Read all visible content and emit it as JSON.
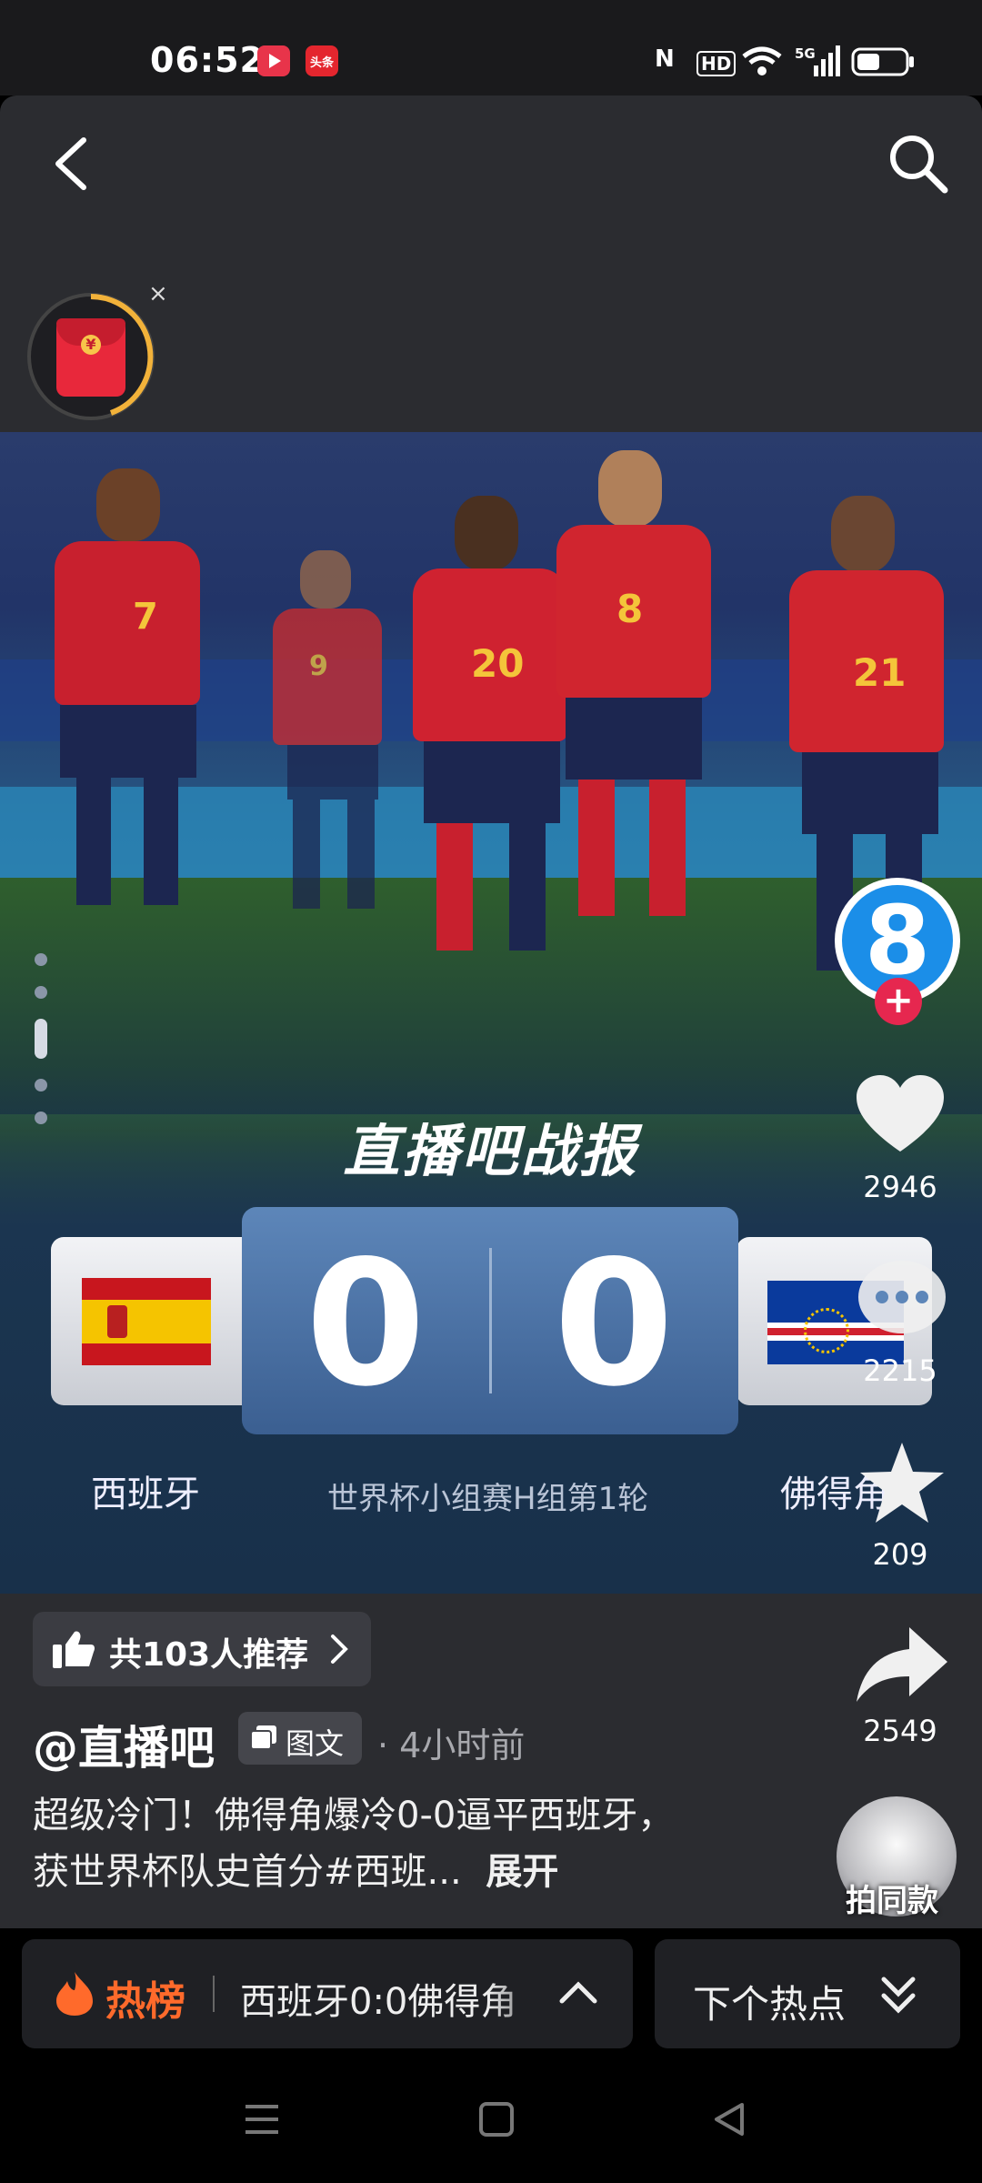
{
  "status_bar": {
    "time": "06:52",
    "app_icon_1": "video-app-icon",
    "app_icon_2": "头条",
    "nfc": "N",
    "hd": "HD",
    "signal": "5G"
  },
  "header": {
    "back_icon": "chevron-left-icon",
    "search_icon": "search-icon",
    "red_packet_symbol": "¥",
    "close_symbol": "×"
  },
  "scoreboard": {
    "brand": "直播吧战报",
    "home_team": "西班牙",
    "away_team": "佛得角",
    "home_score": "0",
    "away_score": "0",
    "match_info": "世界杯小组赛H组第1轮"
  },
  "players": [
    "7",
    "9",
    "20",
    "8",
    "21"
  ],
  "right_rail": {
    "creator_badge": "8",
    "follow_symbol": "+",
    "like_count": "2946",
    "comment_count": "2215",
    "favorite_count": "209",
    "share_count": "2549",
    "same_style_label": "拍同款"
  },
  "post": {
    "recommend_label": "共103人推荐",
    "author": "@直播吧",
    "type_tag": "图文",
    "time_ago": "· 4小时前",
    "description": "超级冷门！佛得角爆冷0-0逼平西班牙，获世界杯队史首分#西班...",
    "expand_label": "展开"
  },
  "bottom": {
    "hot_label": "热榜",
    "hot_topic": "西班牙0:0佛得角",
    "next_label": "下个热点"
  },
  "colors": {
    "accent_red": "#e6274f",
    "hot_orange": "#ff6a2b",
    "panel": "#2b2c30",
    "score_blue": "#4a70a4"
  }
}
